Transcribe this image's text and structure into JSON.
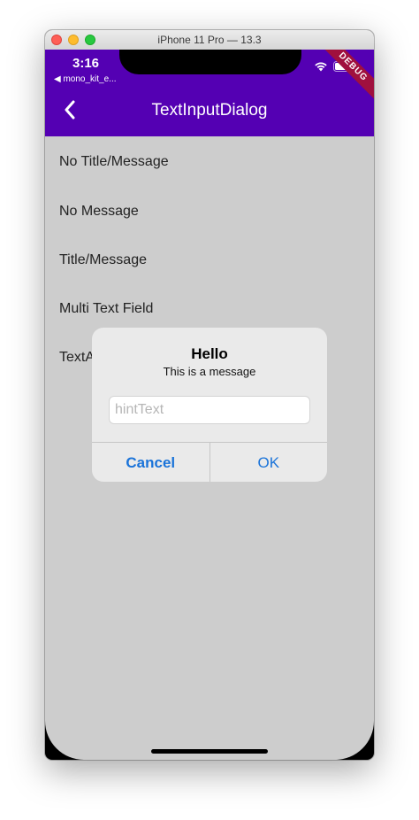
{
  "window": {
    "title": "iPhone 11 Pro — 13.3"
  },
  "status_bar": {
    "time": "3:16",
    "back_to_app": "◀ mono_kit_e...",
    "debug_banner": "DEBUG"
  },
  "app_bar": {
    "title": "TextInputDialog",
    "background": "#5400b3"
  },
  "list": {
    "items": [
      {
        "label": "No Title/Message"
      },
      {
        "label": "No Message"
      },
      {
        "label": "Title/Message"
      },
      {
        "label": "Multi Text Field"
      },
      {
        "label": "TextA"
      }
    ]
  },
  "dialog": {
    "title": "Hello",
    "message": "This is a message",
    "input_placeholder": "hintText",
    "input_value": "",
    "cancel_label": "Cancel",
    "ok_label": "OK",
    "accent": "#1a73d9"
  },
  "icons": {
    "back": "chevron-left-icon",
    "wifi": "wifi-icon",
    "battery": "battery-icon"
  }
}
